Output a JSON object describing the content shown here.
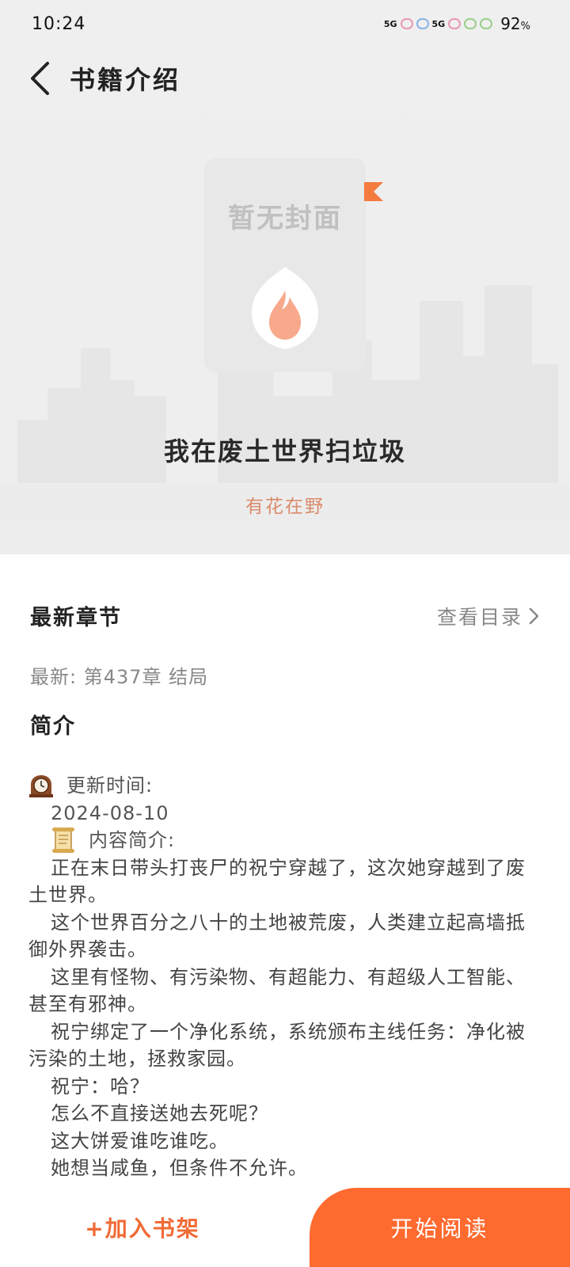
{
  "status_bar": {
    "time": "10:24",
    "battery": "92",
    "battery_unit": "%",
    "signal_1": "5G",
    "signal_2": "5G"
  },
  "header": {
    "title": "书籍介绍"
  },
  "cover": {
    "placeholder_text": "暂无封面"
  },
  "book": {
    "title": "我在废土世界扫垃圾",
    "author": "有花在野"
  },
  "latest_chapter": {
    "heading": "最新章节",
    "toc_label": "查看目录",
    "latest_text": "最新: 第437章 结局"
  },
  "intro": {
    "heading": "简介",
    "update_label": "更新时间:",
    "update_date": "2024-08-10",
    "content_label": "内容简介:",
    "paragraphs": [
      "正在末日带头打丧尸的祝宁穿越了，这次她穿越到了废土世界。",
      "这个世界百分之八十的土地被荒废，人类建立起高墙抵御外界袭击。",
      "这里有怪物、有污染物、有超能力、有超级人工智能、甚至有邪神。",
      "祝宁绑定了一个净化系统，系统颁布主线任务：净化被污染的土地，拯救家园。",
      "祝宁：哈？",
      "怎么不直接送她去死呢？",
      "这大饼爱谁吃谁吃。",
      "她想当咸鱼，但条件不允许。"
    ]
  },
  "bottom": {
    "add_shelf_label": "+加入书架",
    "start_read_label": "开始阅读"
  },
  "colors": {
    "accent": "#ff6a2f",
    "author": "#d98b6b"
  }
}
